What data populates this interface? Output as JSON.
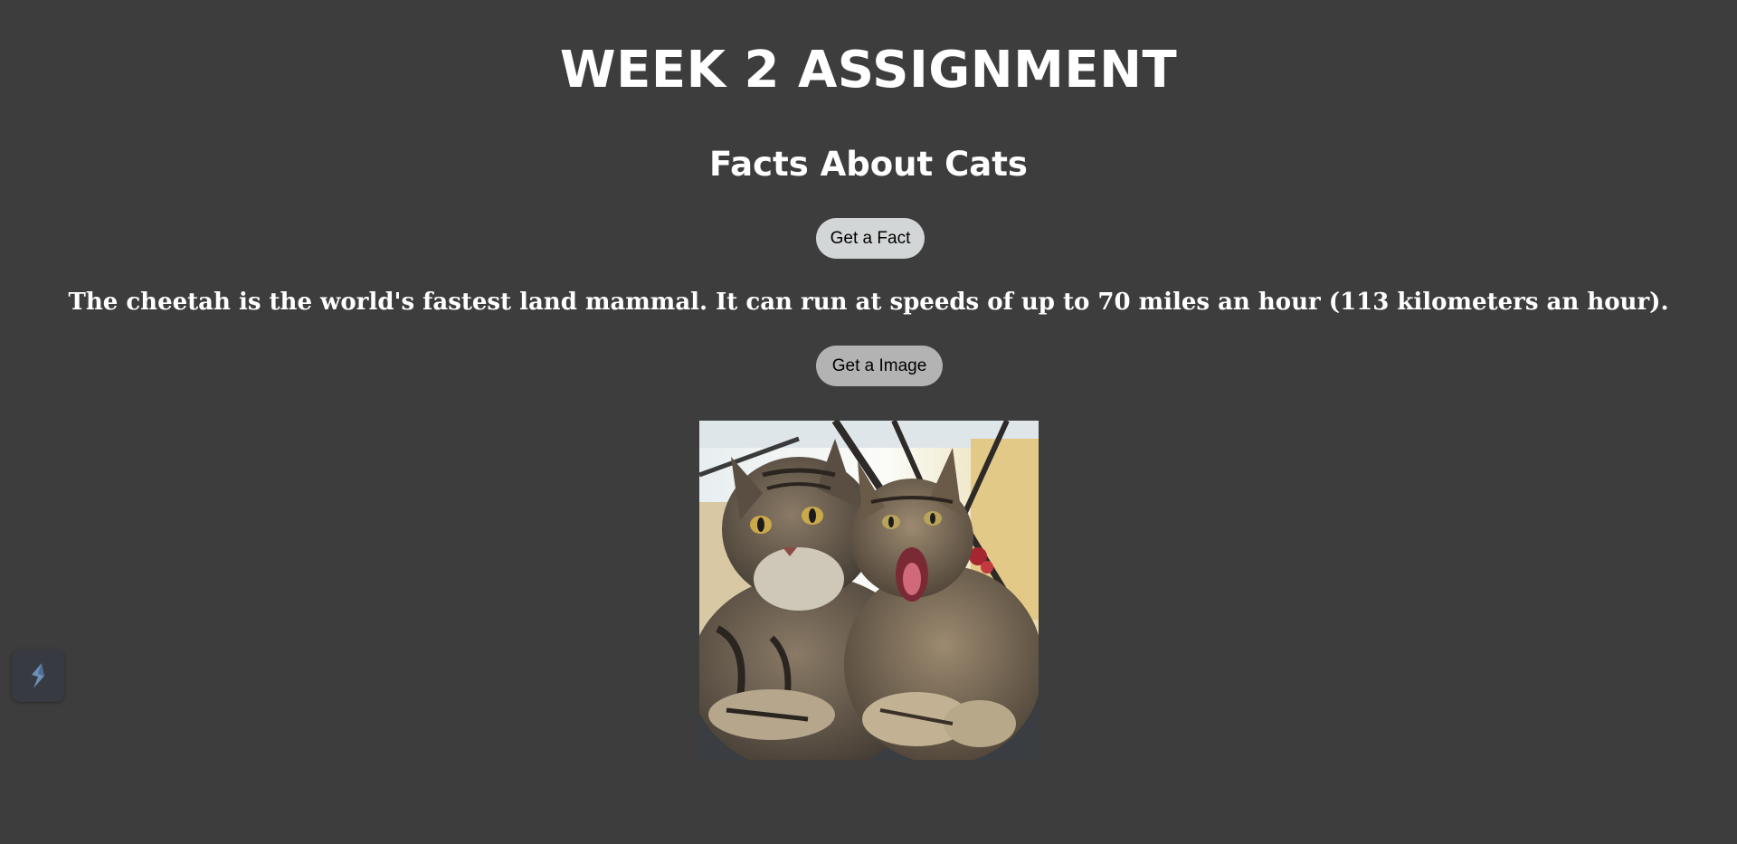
{
  "page": {
    "title": "WEEK 2 ASSIGNMENT",
    "subtitle": "Facts About Cats"
  },
  "buttons": {
    "fact_label": "Get a Fact",
    "image_label": "Get a Image"
  },
  "fact": {
    "text": "The cheetah is the world's fastest land mammal. It can run at speeds of up to 70 miles an hour (113 kilometers an hour)."
  },
  "image": {
    "subject": "two tabby cats, one yawning"
  },
  "widget": {
    "icon": "s-logo-icon"
  },
  "colors": {
    "background": "#3d3d3d",
    "text": "#ffffff",
    "fact_button": "#d3d6d6",
    "image_button": "#b3b3b3"
  }
}
